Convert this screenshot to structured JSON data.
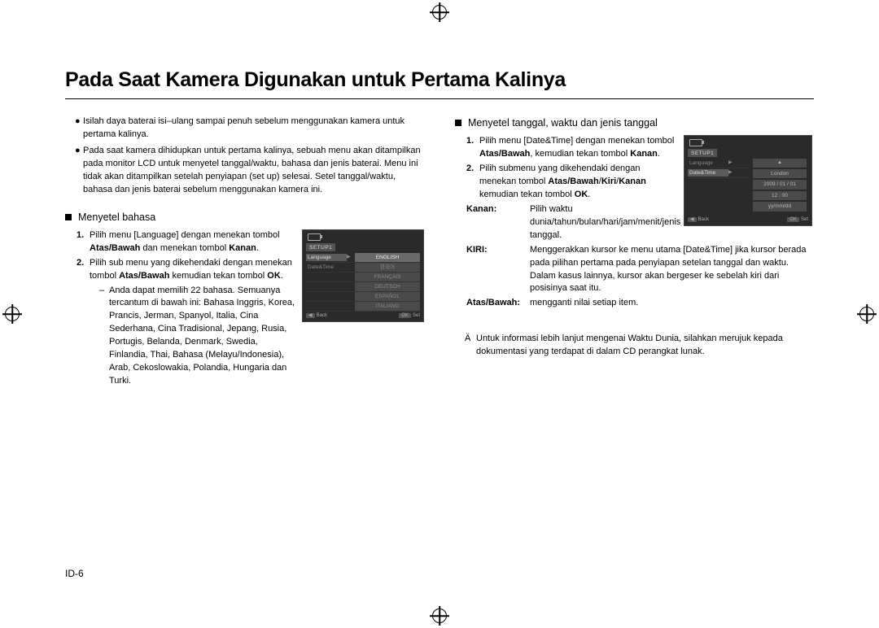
{
  "title": "Pada Saat Kamera Digunakan untuk Pertama Kalinya",
  "left": {
    "b1": "Isilah daya baterai isi–ulang sampai penuh sebelum menggunakan kamera untuk pertama kalinya.",
    "b2": "Pada saat kamera dihidupkan untuk pertama kalinya, sebuah menu akan ditampilkan pada monitor LCD untuk menyetel tanggal/waktu, bahasa dan jenis baterai. Menu ini tidak akan ditampilkan setelah penyiapan (set up) selesai. Setel  tanggal/waktu, bahasa  dan jenis baterai sebelum menggunakan kamera ini.",
    "subhead": "Menyetel bahasa",
    "s1a": "Pilih menu [Language] dengan menekan tombol ",
    "s1b": "Atas/Bawah",
    "s1c": " dan menekan tombol ",
    "s1d": "Kanan",
    "s1e": ".",
    "s2a": "Pilih sub menu yang dikehendaki dengan menekan tombol ",
    "s2b": "Atas/Bawah",
    "s2c": " kemudian tekan tombol ",
    "s2d": "OK",
    "s2e": ".",
    "sub_dash": "Anda dapat memilih 22 bahasa. Semuanya tercantum di bawah ini: Bahasa Inggris, Korea, Prancis, Jerman, Spanyol, Italia, Cina Sederhana, Cina Tradisional, Jepang, Rusia, Portugis, Belanda, Denmark, Swedia, Finlandia, Thai, Bahasa (Melayu/Indonesia), Arab, Cekoslowakia, Polandia, Hungaria dan Turki.",
    "lcd": {
      "tab": "SETUP1",
      "row1_label": "Language",
      "row2_label": "Date&Time",
      "vals": [
        "ENGLISH",
        "한국어",
        "FRANÇAIS",
        "DEUTSCH",
        "ESPAÑOL",
        "ITALIANO"
      ],
      "back": "Back",
      "ok": "OK",
      "set": "Set"
    }
  },
  "right": {
    "subhead": "Menyetel tanggal, waktu dan jenis tanggal",
    "s1a": "Pilih menu [Date&Time] dengan menekan tombol ",
    "s1b": "Atas/Bawah",
    "s1c": ", kemudian tekan tombol ",
    "s1d": "Kanan",
    "s1e": ".",
    "s2a": "Pilih submenu yang dikehendaki dengan menekan tombol ",
    "s2b": "Atas/Bawah",
    "s2c": "/",
    "s2d": "Kiri",
    "s2e": "/",
    "s2f": "Kanan",
    "s2g": " kemudian tekan tombol ",
    "s2h": "OK",
    "s2i": ".",
    "kv": {
      "k1": "Kanan",
      "v1": "Pilih waktu dunia/tahun/bulan/hari/jam/menit/jenis tanggal.",
      "k2": "KIRI",
      "v2": "Menggerakkan kursor ke menu utama [Date&Time] jika kursor berada pada pilihan pertama pada penyiapan setelan tanggal dan waktu. Dalam kasus lainnya, kursor akan bergeser ke sebelah kiri dari posisinya saat itu.",
      "k3": "Atas/Bawah",
      "v3": "mengganti nilai setiap item."
    },
    "note": "Untuk informasi lebih lanjut mengenai Waktu Dunia, silahkan merujuk kepada dokumentasi yang terdapat di dalam CD perangkat lunak.",
    "lcd": {
      "tab": "SETUP1",
      "row1_label": "Language",
      "row2_label": "Date&Time",
      "v1": "London",
      "v2": "2009 / 01 / 01",
      "v3": "12 : 00",
      "v4": "yy/mm/dd",
      "back": "Back",
      "ok": "OK",
      "set": "Set"
    }
  },
  "page_num": "ID-6"
}
